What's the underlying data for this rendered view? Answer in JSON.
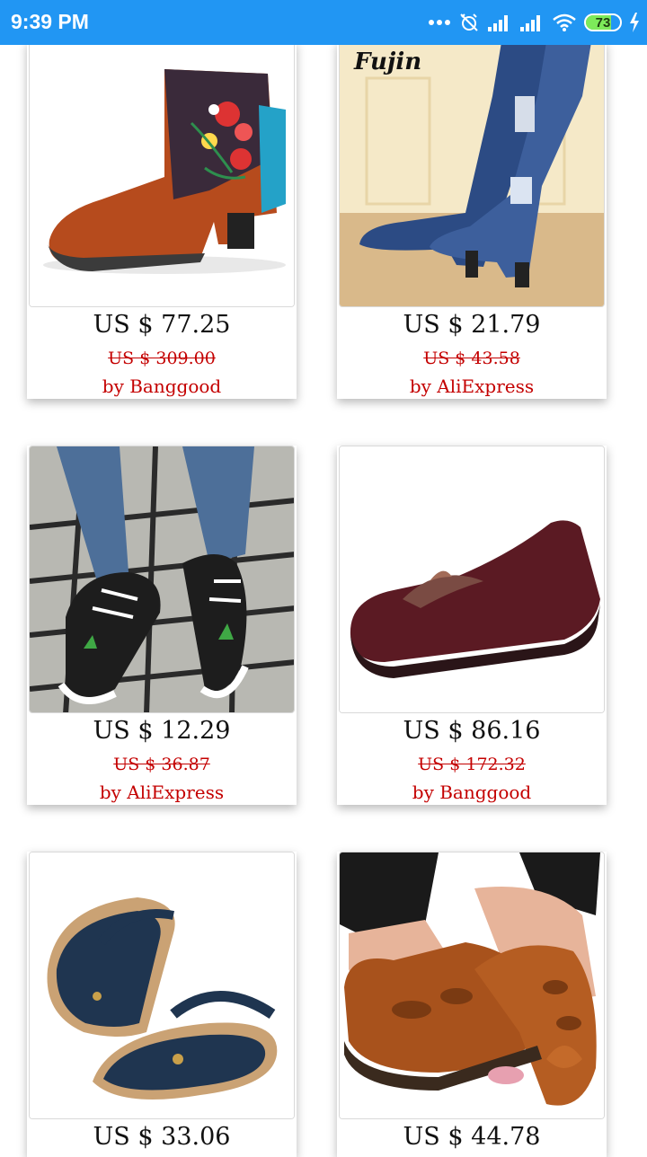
{
  "status_bar": {
    "time": "9:39 PM",
    "battery": "73",
    "icons": [
      "more-icon",
      "alarm-off-icon",
      "signal-icon",
      "signal-icon",
      "wifi-icon",
      "battery-icon",
      "charging-icon"
    ]
  },
  "products": [
    {
      "image": "boot-embroidered-icon",
      "price": "US $ 77.25",
      "old_price": "US $ 309.00",
      "store": "by Banggood"
    },
    {
      "image": "denim-thigh-boot-icon",
      "brand": "Fujin",
      "price": "US $ 21.79",
      "old_price": "US $ 43.58",
      "store": "by AliExpress"
    },
    {
      "image": "leaf-sneaker-icon",
      "price": "US $ 12.29",
      "old_price": "US $ 36.87",
      "store": "by AliExpress"
    },
    {
      "image": "burgundy-loafer-icon",
      "price": "US $ 86.16",
      "old_price": "US $ 172.32",
      "store": "by Banggood"
    },
    {
      "image": "blue-sandal-icon",
      "price": "US $ 33.06"
    },
    {
      "image": "brown-leather-shoe-icon",
      "price": "US $ 44.78"
    }
  ],
  "colors": {
    "status_bar": "#2196f3",
    "old_price": "#c40000",
    "store": "#c40000"
  }
}
